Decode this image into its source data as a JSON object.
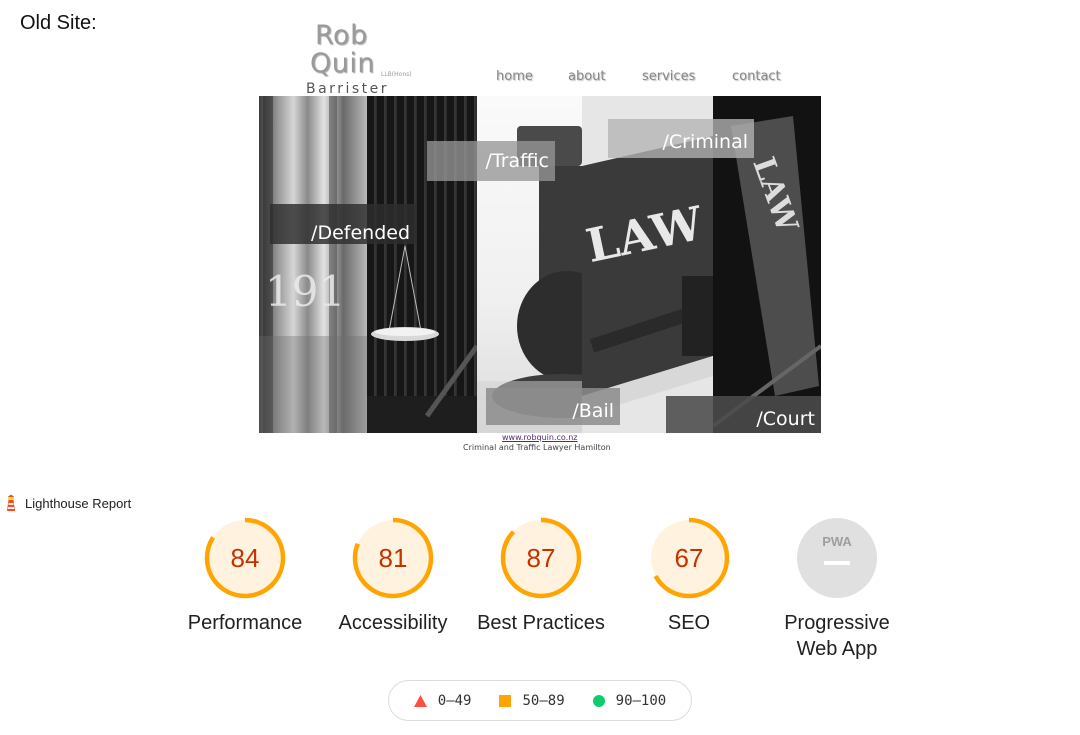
{
  "heading": "Old Site:",
  "site": {
    "logo": {
      "line1": "Rob",
      "line2": "Quin",
      "small": "LLB(Hons)",
      "line3": "Barrister"
    },
    "nav": [
      "home",
      "about",
      "services",
      "contact"
    ],
    "tags": {
      "defended": "/Defended",
      "traffic": "/Traffic",
      "criminal": "/Criminal",
      "bail": "/Bail",
      "court": "/Court"
    },
    "panel_words": {
      "law1": "LAW",
      "law2": "LAW",
      "year": "191"
    },
    "footer": {
      "link": "www.robquin.co.nz",
      "subtitle": "Criminal and Traffic Lawyer Hamilton"
    }
  },
  "lighthouse": {
    "title": "Lighthouse Report",
    "scores": [
      {
        "label": "Performance",
        "value": "84",
        "fraction": 0.84
      },
      {
        "label": "Accessibility",
        "value": "81",
        "fraction": 0.81
      },
      {
        "label": "Best Practices",
        "value": "87",
        "fraction": 0.87
      },
      {
        "label": "SEO",
        "value": "67",
        "fraction": 0.67
      }
    ],
    "pwa": {
      "label": "Progressive Web App",
      "badge": "PWA"
    },
    "legend": {
      "fail": "0–49",
      "average": "50–89",
      "pass": "90–100"
    },
    "colors": {
      "fail": "#ff4e42",
      "average": "#ffa400",
      "pass": "#0cce6b",
      "average_bg": "#fff3e0",
      "pwa_bg": "#e0e0e0"
    }
  }
}
